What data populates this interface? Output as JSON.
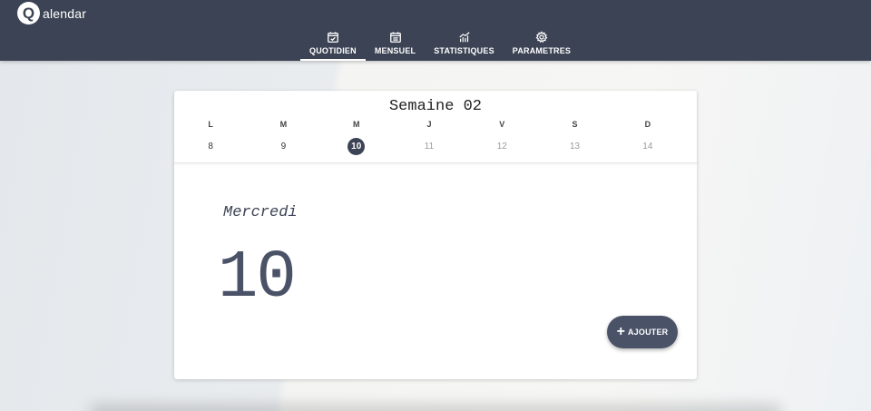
{
  "app": {
    "logo_letter": "Q",
    "logo_text": "alendar"
  },
  "nav": [
    {
      "label": "QUOTIDIEN",
      "icon": "calendar-check-icon",
      "active": true
    },
    {
      "label": "MENSUEL",
      "icon": "calendar-month-icon",
      "active": false
    },
    {
      "label": "STATISTIQUES",
      "icon": "chart-icon",
      "active": false
    },
    {
      "label": "PARAMETRES",
      "icon": "gear-icon",
      "active": false
    }
  ],
  "week": {
    "title": "Semaine 02",
    "days": [
      {
        "letter": "L",
        "num": "8"
      },
      {
        "letter": "M",
        "num": "9"
      },
      {
        "letter": "M",
        "num": "10"
      },
      {
        "letter": "J",
        "num": "11"
      },
      {
        "letter": "V",
        "num": "12"
      },
      {
        "letter": "S",
        "num": "13"
      },
      {
        "letter": "D",
        "num": "14"
      }
    ],
    "selected_index": 2
  },
  "detail": {
    "day_name": "Mercredi",
    "day_number": "10"
  },
  "add_button": {
    "icon": "plus",
    "label": "AJOUTER"
  },
  "colors": {
    "topbar": "#3c4354",
    "accent": "#4a5268"
  }
}
